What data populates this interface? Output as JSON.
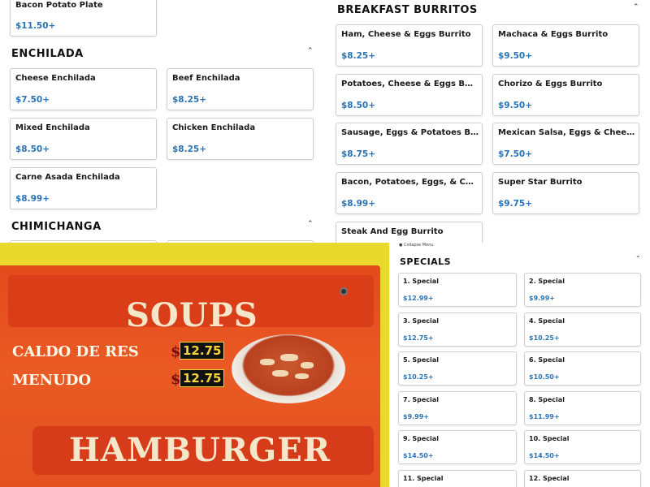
{
  "left_panel": {
    "top_card": {
      "name": "Bacon Potato Plate",
      "price": "$11.50+"
    },
    "enchilada": {
      "title": "ENCHILADA",
      "items": [
        {
          "name": "Cheese Enchilada",
          "price": "$7.50+"
        },
        {
          "name": "Beef Enchilada",
          "price": "$8.25+"
        },
        {
          "name": "Mixed Enchilada",
          "price": "$8.50+"
        },
        {
          "name": "Chicken Enchilada",
          "price": "$8.25+"
        },
        {
          "name": "Carne Asada Enchilada",
          "price": "$8.99+"
        }
      ]
    },
    "chimichanga": {
      "title": "CHIMICHANGA"
    }
  },
  "right_panel": {
    "breakfast": {
      "title": "BREAKFAST BURRITOS",
      "items": [
        {
          "name": "Ham, Cheese & Eggs Burrito",
          "price": "$8.25+"
        },
        {
          "name": "Machaca & Eggs Burrito",
          "price": "$9.50+"
        },
        {
          "name": "Potatoes, Cheese & Eggs Burrito",
          "price": "$8.50+"
        },
        {
          "name": "Chorizo & Eggs Burrito",
          "price": "$9.50+"
        },
        {
          "name": "Sausage, Eggs & Potatoes Burrito",
          "price": "$8.75+"
        },
        {
          "name": "Mexican Salsa, Eggs & Cheese…",
          "price": "$7.50+"
        },
        {
          "name": "Bacon, Potatoes, Eggs, & Cheese…",
          "price": "$8.99+"
        },
        {
          "name": "Super Star Burrito",
          "price": "$9.75+"
        },
        {
          "name": "Steak And Egg Burrito",
          "price": ""
        }
      ]
    }
  },
  "specials_panel": {
    "collapse_label": "Collapse Menu",
    "title": "SPECIALS",
    "items": [
      {
        "name": "1. Special",
        "price": "$12.99+"
      },
      {
        "name": "2. Special",
        "price": "$9.99+"
      },
      {
        "name": "3. Special",
        "price": "$12.75+"
      },
      {
        "name": "4. Special",
        "price": "$10.25+"
      },
      {
        "name": "5. Special",
        "price": "$10.25+"
      },
      {
        "name": "6. Special",
        "price": "$10.50+"
      },
      {
        "name": "7. Special",
        "price": "$9.99+"
      },
      {
        "name": "8. Special",
        "price": "$11.99+"
      },
      {
        "name": "9. Special",
        "price": "$14.50+"
      },
      {
        "name": "10. Special",
        "price": "$14.50+"
      },
      {
        "name": "11. Special",
        "price": ""
      },
      {
        "name": "12. Special",
        "price": ""
      }
    ]
  },
  "photo": {
    "heading": "SOUPS",
    "items": [
      {
        "name": "CALDO DE RES",
        "dollar": "$",
        "price": "12.75"
      },
      {
        "name": "MENUDO",
        "dollar": "$",
        "price": "12.75"
      }
    ],
    "footer_heading": "HAMBURGER"
  },
  "icons": {
    "collapse": "chevron-up-icon"
  },
  "colors": {
    "price": "#2a74b5",
    "sign": "#e34a1c",
    "wall": "#e9d92a"
  }
}
